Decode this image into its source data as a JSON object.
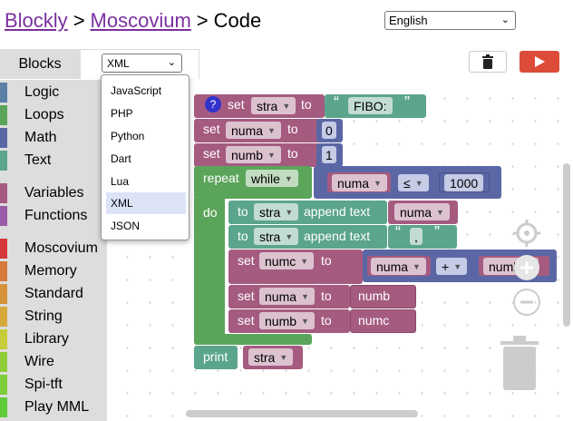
{
  "header": {
    "crumb1": "Blockly",
    "sep1": ">",
    "crumb2": "Moscovium",
    "sep2": ">",
    "crumb3": "Code"
  },
  "language": {
    "selected": "English"
  },
  "tabs": {
    "blocks": "Blocks",
    "code_format": "XML"
  },
  "toolbox": {
    "categories": [
      {
        "label": "Logic",
        "color": "#5b80a5"
      },
      {
        "label": "Loops",
        "color": "#5ba55b"
      },
      {
        "label": "Math",
        "color": "#5b67a5"
      },
      {
        "label": "Text",
        "color": "#5ba58c"
      },
      {
        "label": "Variables",
        "color": "#a55b80"
      },
      {
        "label": "Functions",
        "color": "#995ba5"
      },
      {
        "label": "Moscovium",
        "color": "#d6373a"
      },
      {
        "label": "Memory",
        "color": "#d6793a"
      },
      {
        "label": "Standard",
        "color": "#d6923a"
      },
      {
        "label": "String",
        "color": "#d6a83a"
      },
      {
        "label": "Library",
        "color": "#c6cc3a"
      },
      {
        "label": "Wire",
        "color": "#8fcc3a"
      },
      {
        "label": "Spi-tft",
        "color": "#7fcc3a"
      },
      {
        "label": "Play MML",
        "color": "#5fcc3a"
      }
    ]
  },
  "code_menu": {
    "options": [
      "JavaScript",
      "PHP",
      "Python",
      "Dart",
      "Lua",
      "XML",
      "JSON"
    ],
    "selected": "XML"
  },
  "program": {
    "help": "?",
    "set": "set",
    "to": "to",
    "repeat": "repeat",
    "while": "while",
    "do": "do",
    "append_text": "append text",
    "print": "print",
    "var_stra": "stra",
    "var_numa": "numa",
    "var_numb": "numb",
    "var_numc": "numc",
    "str_fibo": "FIBO:",
    "str_comma": ",",
    "num_0": "0",
    "num_1": "1",
    "num_1000": "1000",
    "op_le": "≤",
    "op_plus": "+",
    "quote_open": "“",
    "quote_close": "”"
  },
  "colors": {
    "variables": "#a55b80",
    "loops": "#5ba55b",
    "math": "#5b67a5",
    "text": "#5ba58c",
    "run": "#dd4b39"
  },
  "icons": {
    "trash": "trash-icon",
    "run": "play-icon",
    "help": "help-icon"
  }
}
